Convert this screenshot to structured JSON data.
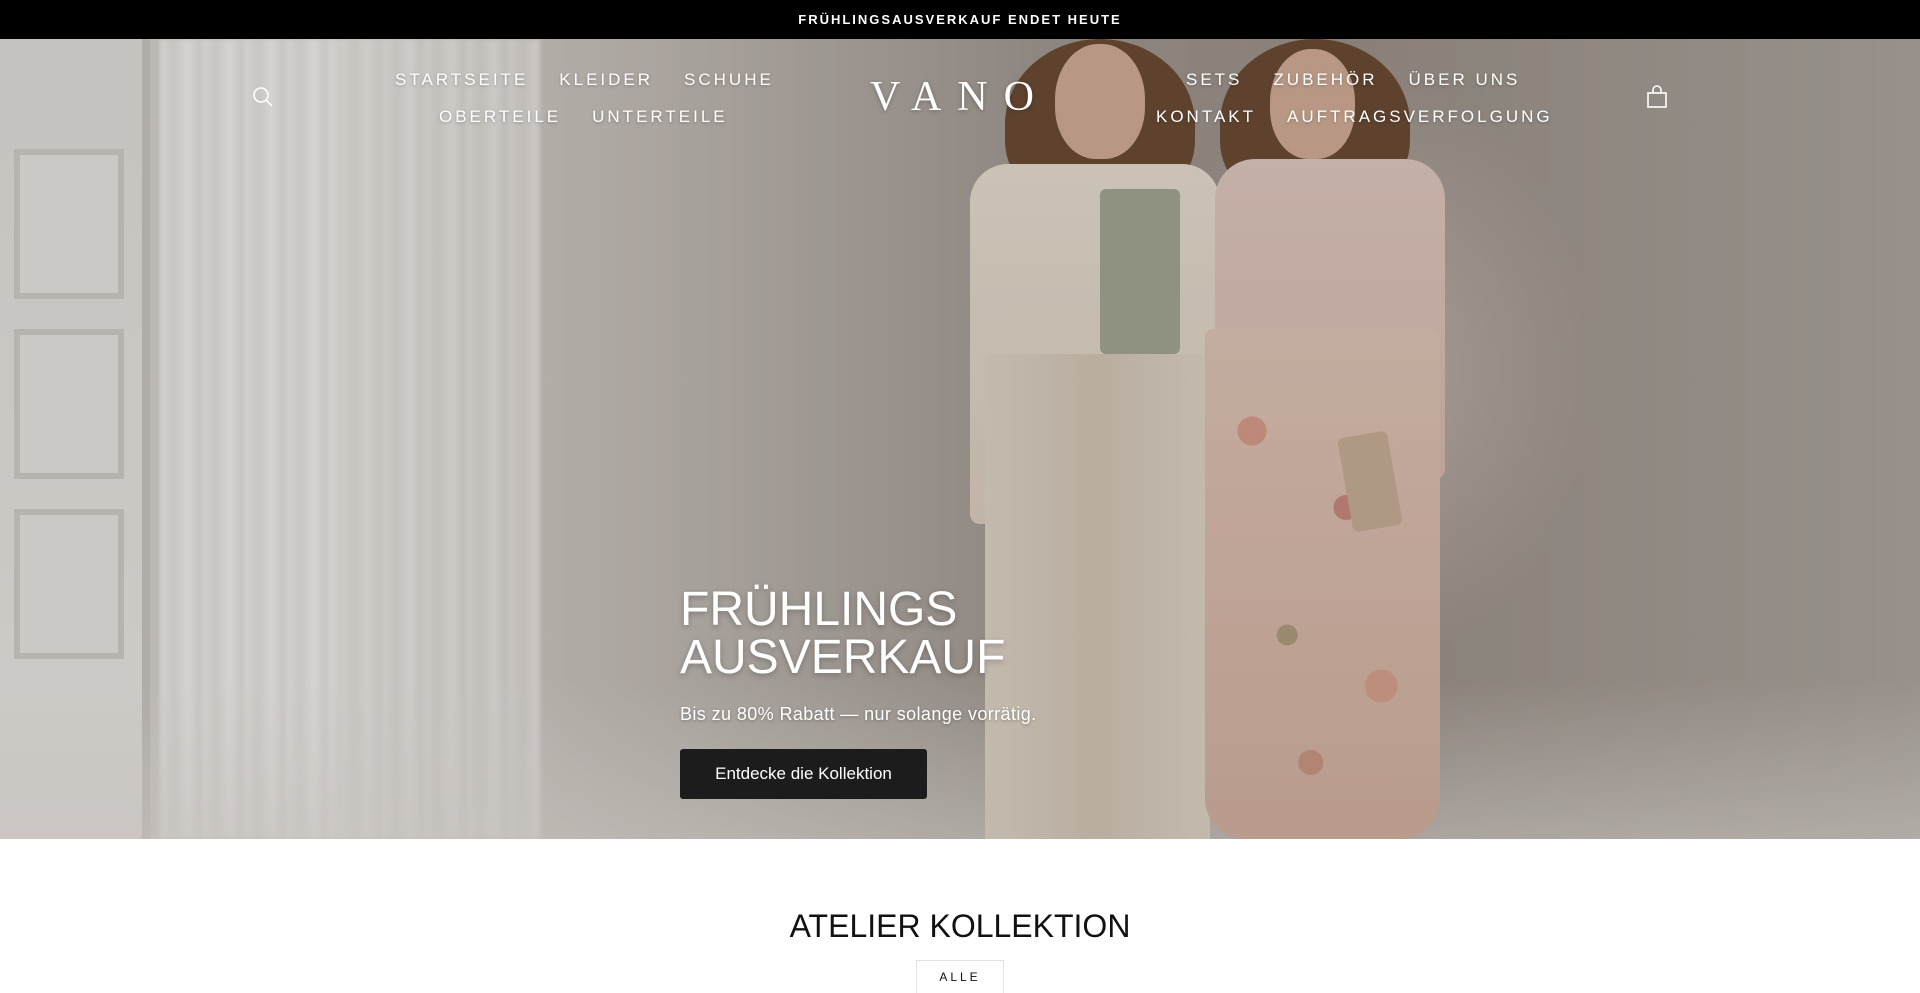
{
  "announcement": {
    "text": "FRÜHLINGSAUSVERKAUF ENDET HEUTE"
  },
  "header": {
    "logo": "VANO",
    "nav_left_row1": [
      "STARTSEITE",
      "KLEIDER",
      "SCHUHE"
    ],
    "nav_left_row2": [
      "OBERTEILE",
      "UNTERTEILE"
    ],
    "nav_right_row1": [
      "SETS",
      "ZUBEHÖR",
      "ÜBER UNS"
    ],
    "nav_right_row2": [
      "KONTAKT",
      "AUFTRAGSVERFOLGUNG"
    ],
    "icons": {
      "search": "search-icon",
      "cart": "shopping-bag-icon"
    }
  },
  "hero": {
    "title_line1": "FRÜHLINGS",
    "title_line2": "AUSVERKAUF",
    "subtitle": "Bis zu 80% Rabatt — nur solange vorrätig.",
    "cta_label": "Entdecke die Kollektion"
  },
  "collection": {
    "title": "ATELIER KOLLEKTION",
    "filter_label": "ALLE"
  },
  "colors": {
    "announcement_bg": "#000000",
    "cta_bg": "#1c1c1c",
    "text_on_hero": "#ffffff"
  }
}
